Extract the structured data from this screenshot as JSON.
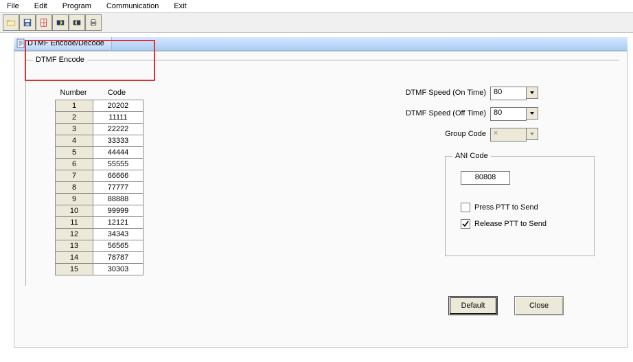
{
  "menu": {
    "file": "File",
    "edit": "Edit",
    "program": "Program",
    "communication": "Communication",
    "exit": "Exit"
  },
  "tab": {
    "title": "DTMF Encode/Decode"
  },
  "groupbox": {
    "encode": "DTMF Encode",
    "ani": "ANI Code"
  },
  "headers": {
    "number": "Number",
    "code": "Code"
  },
  "rows": [
    {
      "n": "1",
      "c": "20202"
    },
    {
      "n": "2",
      "c": "11111"
    },
    {
      "n": "3",
      "c": "22222"
    },
    {
      "n": "4",
      "c": "33333"
    },
    {
      "n": "5",
      "c": "44444"
    },
    {
      "n": "6",
      "c": "55555"
    },
    {
      "n": "7",
      "c": "66666"
    },
    {
      "n": "8",
      "c": "77777"
    },
    {
      "n": "9",
      "c": "88888"
    },
    {
      "n": "10",
      "c": "99999"
    },
    {
      "n": "11",
      "c": "12121"
    },
    {
      "n": "12",
      "c": "34343"
    },
    {
      "n": "13",
      "c": "56565"
    },
    {
      "n": "14",
      "c": "78787"
    },
    {
      "n": "15",
      "c": "30303"
    }
  ],
  "labels": {
    "speed_on": "DTMF Speed (On Time)",
    "speed_off": "DTMF Speed (Off Time)",
    "group_code": "Group Code",
    "press_ptt": "Press PTT to Send",
    "release_ptt": "Release PTT to Send"
  },
  "values": {
    "speed_on": "80",
    "speed_off": "80",
    "group_code": "×",
    "ani_code": "80808"
  },
  "checks": {
    "press_ptt": false,
    "release_ptt": true
  },
  "buttons": {
    "default": "Default",
    "close": "Close"
  },
  "toolbar_icons": [
    "open-icon",
    "save-icon",
    "new-icon",
    "read-icon",
    "write-icon",
    "print-icon"
  ]
}
